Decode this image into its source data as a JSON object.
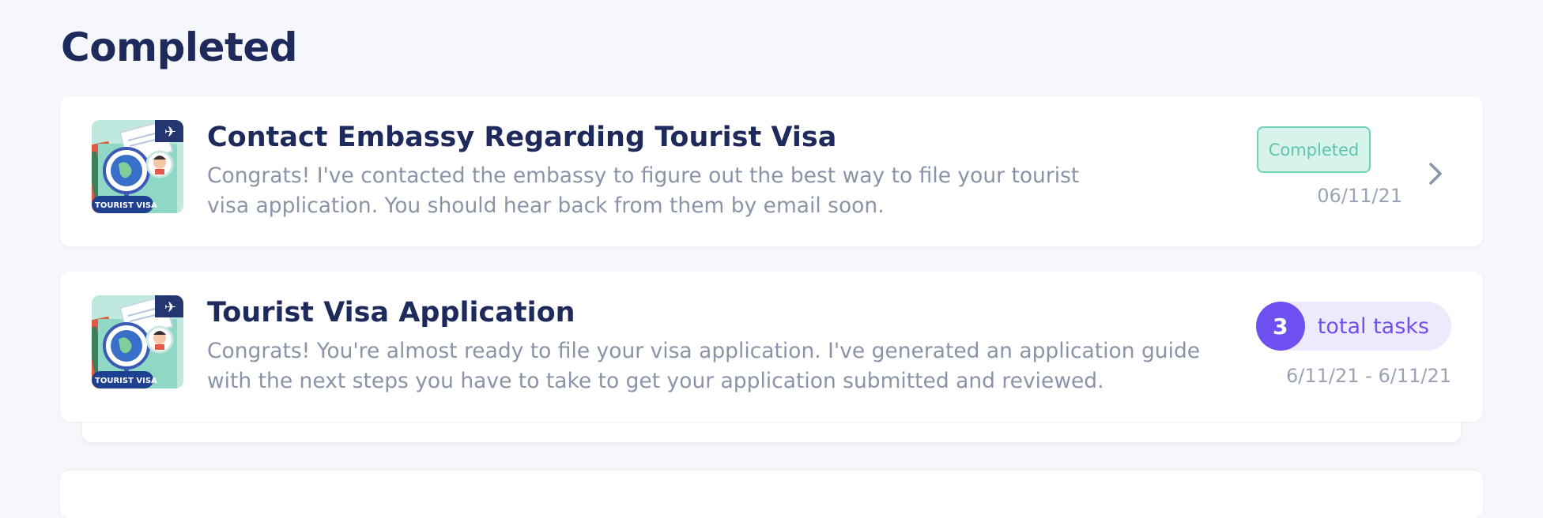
{
  "section": {
    "title": "Completed"
  },
  "tasks": [
    {
      "title": "Contact Embassy Regarding Tourist Visa",
      "description": "Congrats! I've contacted the embassy to figure out the best way to file your tourist visa application. You should hear back from them by email soon.",
      "status": "Completed",
      "date": "06/11/21",
      "thumbnail_label": "TOURIST VISA"
    },
    {
      "title": "Tourist Visa Application",
      "description": "Congrats! You're almost ready to file your visa application. I've generated an application guide with the next steps you have to take to get your application submitted and reviewed.",
      "task_count": "3",
      "task_count_label": "total tasks",
      "date_range": "6/11/21 - 6/11/21",
      "thumbnail_label": "TOURIST VISA"
    }
  ],
  "colors": {
    "title": "#1f2a5c",
    "muted_text": "#8a94a8",
    "completed_accent": "#5dc6aa",
    "tasks_accent": "#6e4ff0",
    "background": "#f5f7fb"
  },
  "icons": {
    "thumbnail": "tourist-visa-illustration",
    "chevron": "chevron-right-icon"
  }
}
